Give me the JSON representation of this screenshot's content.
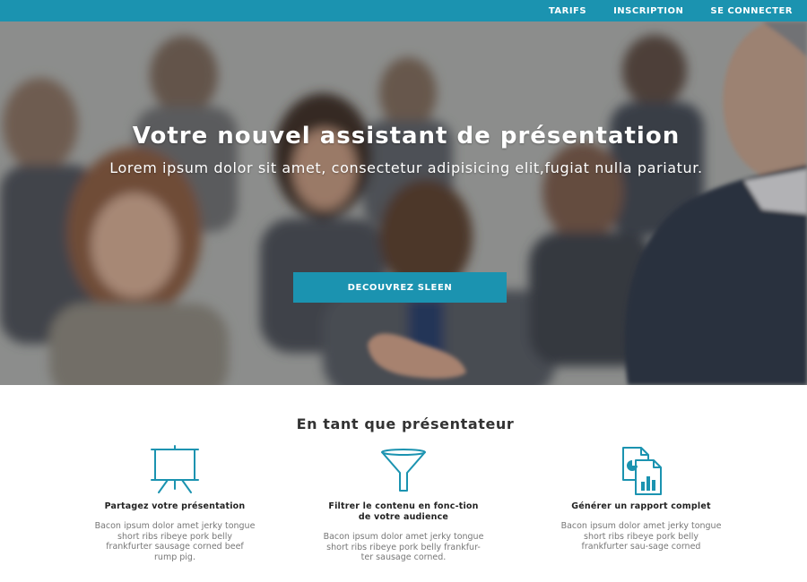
{
  "nav": {
    "items": [
      {
        "label": "TARIFS"
      },
      {
        "label": "INSCRIPTION"
      },
      {
        "label": "SE CONNECTER"
      }
    ]
  },
  "hero": {
    "title": "Votre nouvel assistant de présentation",
    "subtitle": "Lorem ipsum dolor sit amet, consectetur adipisicing elit,fugiat nulla pariatur.",
    "cta_label": "DECOUVREZ SLEEN"
  },
  "section": {
    "title": "En tant que présentateur"
  },
  "features": [
    {
      "icon": "presentation-board-icon",
      "title": "Partagez votre présentation",
      "text": "Bacon ipsum dolor amet jerky tongue short ribs ribeye pork belly frankfurter sausage corned beef rump pig."
    },
    {
      "icon": "funnel-icon",
      "title": "Filtrer le contenu en fonc-tion de votre audience",
      "text": "Bacon ipsum dolor amet jerky tongue short ribs ribeye pork belly frankfur-ter sausage corned."
    },
    {
      "icon": "report-documents-icon",
      "title": "Générer un rapport complet",
      "text": "Bacon ipsum dolor amet jerky tongue short ribs ribeye pork belly frankfurter sau-sage corned"
    }
  ],
  "colors": {
    "accent": "#1b93b0",
    "white": "#ffffff",
    "heading": "#333333",
    "body_text": "#777777"
  }
}
